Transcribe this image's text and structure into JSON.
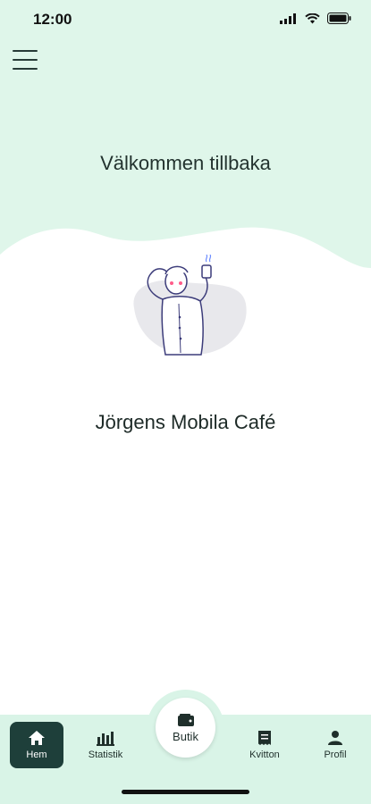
{
  "status_bar": {
    "time": "12:00"
  },
  "main": {
    "welcome": "Välkommen tillbaka",
    "shop_name": "Jörgens Mobila Café"
  },
  "tabbar": {
    "items": [
      {
        "label": "Hem",
        "icon": "home-icon",
        "active": true
      },
      {
        "label": "Statistik",
        "icon": "bar-chart-icon",
        "active": false
      },
      {
        "label": "Butik",
        "icon": "wallet-icon",
        "active": false
      },
      {
        "label": "Kvitton",
        "icon": "receipt-icon",
        "active": false
      },
      {
        "label": "Profil",
        "icon": "person-icon",
        "active": false
      }
    ]
  },
  "colors": {
    "mint": "#d9f4e7",
    "dark_green": "#1e3f3a",
    "accent_pink": "#ff5c8a"
  }
}
